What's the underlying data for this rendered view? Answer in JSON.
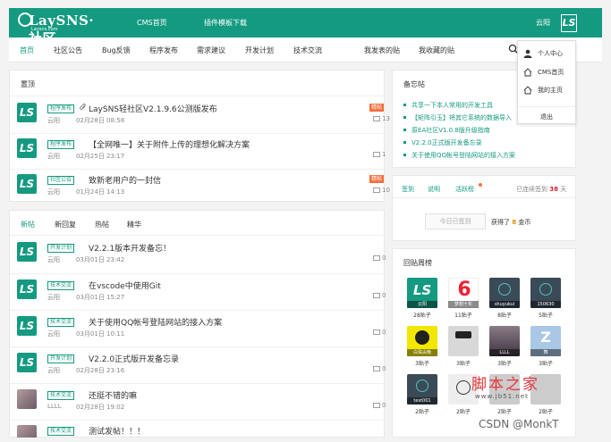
{
  "header": {
    "logo_text": "LaySNS",
    "logo_suffix": "·社区",
    "logo_sub": "Laysns.com",
    "links": [
      "CMS首页",
      "插件模板下载"
    ],
    "user_name": "云阳",
    "avatar_letter": "LS"
  },
  "nav": {
    "items": [
      "首页",
      "社区公告",
      "Bug反馈",
      "程序发布",
      "需求建议",
      "开发计划",
      "技术交流"
    ],
    "right_items": [
      "我发表的贴",
      "我收藏的贴"
    ]
  },
  "dropdown": {
    "items": [
      "个人中心",
      "CMS首页",
      "我的主页",
      "退出"
    ]
  },
  "pinned": {
    "title": "置顶",
    "posts": [
      {
        "tag": "程序发布",
        "title": "LaySNS轻社区V2.1.9.6公测版发布",
        "author": "云阳",
        "time": "02月28日 08:58",
        "badge": "精帖",
        "comments": "13"
      },
      {
        "tag": "程序发布",
        "title": "【全网唯一】关于附件上传的理想化解决方案",
        "author": "云阳",
        "time": "02月25日 23:17",
        "badge": "",
        "comments": "1"
      },
      {
        "tag": "社区公告",
        "title": "致新老用户的一封信",
        "author": "云阳",
        "time": "01月24日 14:13",
        "badge": "精帖",
        "comments": "10"
      }
    ]
  },
  "latest": {
    "tabs": [
      "新帖",
      "新回复",
      "热帖",
      "精华"
    ],
    "posts": [
      {
        "tag": "开发计划",
        "title": "V2.2.1版本开发备忘！",
        "author": "云阳",
        "time": "03月01日 23:42",
        "comments": "0"
      },
      {
        "tag": "技术交流",
        "title": "在vscode中使用Git",
        "author": "云阳",
        "time": "03月01日 15:27",
        "comments": "0"
      },
      {
        "tag": "技术交流",
        "title": "关于使用QQ帐号登陆网站的接入方案",
        "author": "云阳",
        "time": "03月01日 10:11",
        "comments": "0"
      },
      {
        "tag": "开发计划",
        "title": "V2.2.0正式版开发备忘录",
        "author": "云阳",
        "time": "02月28日 23:16",
        "comments": "0"
      },
      {
        "tag": "技术交流",
        "title": "还挺不错的嘛",
        "author": "LLLL",
        "time": "02月28日 19:02",
        "comments": "0"
      },
      {
        "tag": "技术交流",
        "title": "测试发帖！！！",
        "author": "",
        "time": "",
        "comments": ""
      }
    ]
  },
  "memo": {
    "title": "备忘帖",
    "items": [
      "共享一下本人常用的开发工具",
      "【矩阵引玉】将其它系统的数据导入",
      "原EA社区V1.0.8版升级指南",
      "V2.2.0正式版开发备忘录",
      "关于使用QQ帐号登陆网站的接入方案"
    ]
  },
  "sign": {
    "tabs": [
      "签到",
      "说明",
      "活跃榜"
    ],
    "days_prefix": "已连续签到",
    "days": "38",
    "days_suffix": "天",
    "button": "今日已签到",
    "reward_prefix": "获得了",
    "reward": "8",
    "reward_suffix": "金币"
  },
  "rank": {
    "title": "回贴周榜",
    "users": [
      {
        "name": "云阳",
        "count": "28贴子"
      },
      {
        "name": "梦想十年",
        "count": "11贴子"
      },
      {
        "name": "shuyukui",
        "count": "8贴子"
      },
      {
        "name": "150630",
        "count": "5贴子"
      },
      {
        "name": "白珠尖晚",
        "count": "3贴子"
      },
      {
        "name": "",
        "count": "3贴子"
      },
      {
        "name": "LLLL",
        "count": "3贴子"
      },
      {
        "name": "舞",
        "count": "3贴子"
      },
      {
        "name": "test001",
        "count": "2贴子"
      },
      {
        "name": "",
        "count": "2贴子"
      },
      {
        "name": "",
        "count": "2贴子"
      },
      {
        "name": "",
        "count": "2贴子"
      }
    ]
  },
  "watermark": {
    "big": "脚本之家",
    "small": "www.jb51.net",
    "csdn": "CSDN @MonkT"
  },
  "colors": {
    "brand": "#149a80",
    "badge": "#f36f3b",
    "red": "#e0202f"
  }
}
